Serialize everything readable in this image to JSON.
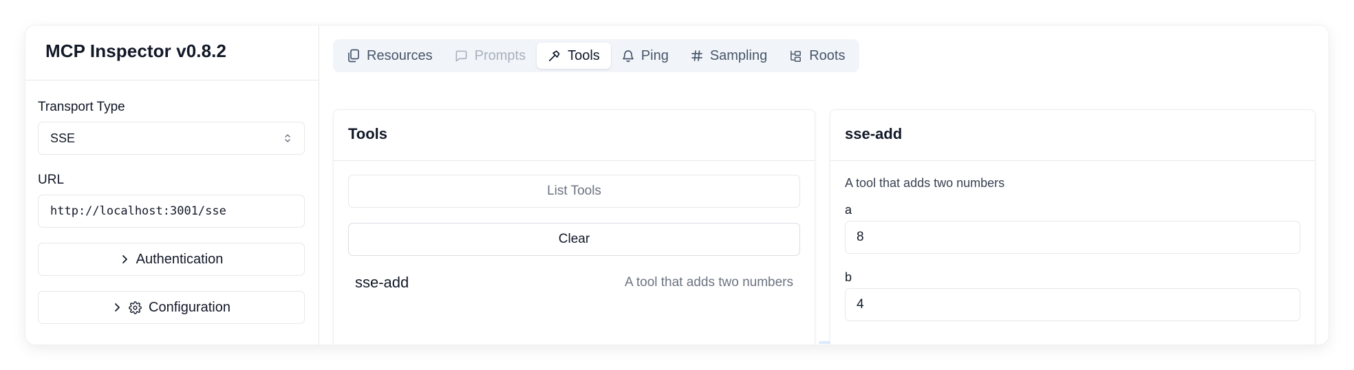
{
  "app": {
    "title": "MCP Inspector v0.8.2"
  },
  "sidebar": {
    "transport_label": "Transport Type",
    "transport_value": "SSE",
    "url_label": "URL",
    "url_value": "http://localhost:3001/sse",
    "auth_button": "Authentication",
    "config_button": "Configuration"
  },
  "tabs": [
    {
      "label": "Resources",
      "icon": "files-icon",
      "state": "normal"
    },
    {
      "label": "Prompts",
      "icon": "message-square-icon",
      "state": "disabled"
    },
    {
      "label": "Tools",
      "icon": "hammer-icon",
      "state": "active"
    },
    {
      "label": "Ping",
      "icon": "bell-icon",
      "state": "normal"
    },
    {
      "label": "Sampling",
      "icon": "hash-icon",
      "state": "normal"
    },
    {
      "label": "Roots",
      "icon": "folder-tree-icon",
      "state": "normal"
    }
  ],
  "tools_panel": {
    "title": "Tools",
    "list_button": "List Tools",
    "clear_button": "Clear",
    "items": [
      {
        "name": "sse-add",
        "description": "A tool that adds two numbers"
      }
    ]
  },
  "detail_panel": {
    "title": "sse-add",
    "description": "A tool that adds two numbers",
    "params": [
      {
        "name": "a",
        "value": "8"
      },
      {
        "name": "b",
        "value": "4"
      }
    ]
  },
  "colors": {
    "tab_bar_bg": "#f1f5f9",
    "disabled_text": "#a8b0bd",
    "muted_text": "#6b7280",
    "border": "#e5e7eb"
  }
}
